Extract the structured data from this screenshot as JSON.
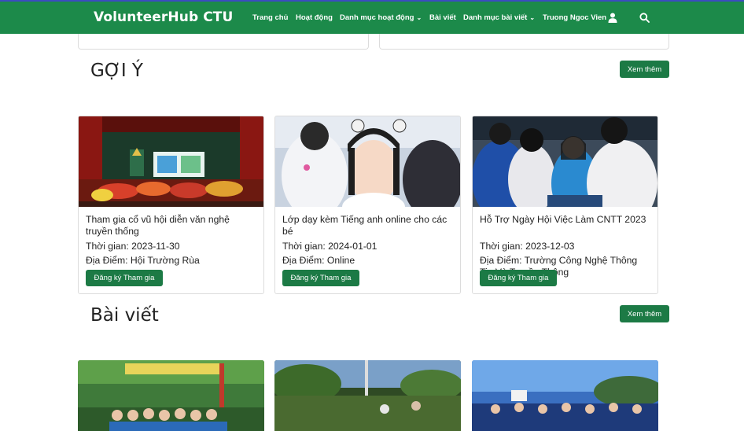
{
  "navbar": {
    "brand": "VolunteerHub CTU",
    "items": [
      {
        "label": "Trang chủ"
      },
      {
        "label": "Hoạt động"
      },
      {
        "label": "Danh mục hoạt động",
        "dropdown": true
      },
      {
        "label": "Bài viết"
      },
      {
        "label": "Danh mục bài viết",
        "dropdown": true
      },
      {
        "label": "Truong Ngoc Vien"
      }
    ],
    "icons": [
      "user-icon",
      "search-icon"
    ]
  },
  "suggest": {
    "title": "GỢI Ý",
    "more_label": "Xem thêm",
    "cards": [
      {
        "title": "Tham gia cổ vũ hội diễn văn nghệ truyền thống",
        "time": "Thời gian: 2023-11-30",
        "place": "Địa Điểm: Hội Trường Rùa",
        "button": "Đăng ký Tham gia"
      },
      {
        "title": "Lớp dạy kèm Tiếng anh online cho các bé",
        "time": "Thời gian: 2024-01-01",
        "place": "Địa Điểm: Online",
        "button": "Đăng ký Tham gia"
      },
      {
        "title": "Hỗ Trợ Ngày Hội Việc Làm CNTT 2023",
        "time": "Thời gian: 2023-12-03",
        "place": "Địa Điểm: Trường Công Nghệ Thông Tin Và Truyền Thông",
        "button": "Đăng ký Tham gia"
      }
    ]
  },
  "posts": {
    "title": "Bài viết",
    "more_label": "Xem thêm"
  },
  "colors": {
    "navbar": "#1c8a4a",
    "button": "#1c7a45"
  }
}
